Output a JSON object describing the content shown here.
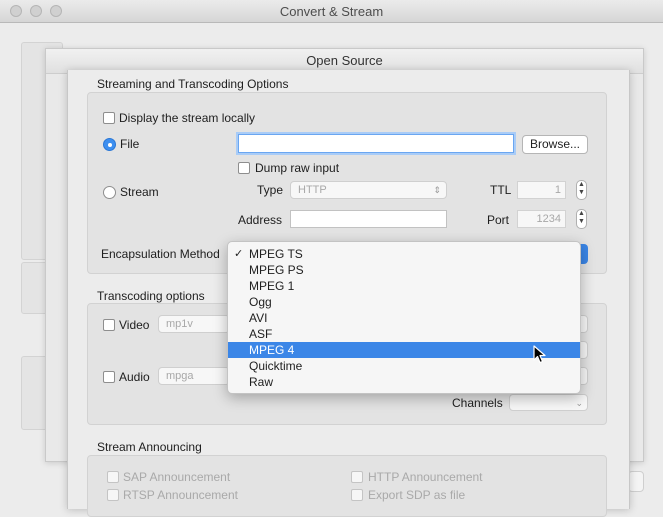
{
  "window": {
    "title": "Convert & Stream"
  },
  "open_source": {
    "title": "Open Source"
  },
  "streaming": {
    "section_title": "Streaming and Transcoding Options",
    "display_locally": "Display the stream locally",
    "file_label": "File",
    "file_path": "",
    "browse_label": "Browse...",
    "dump_raw_label": "Dump raw input",
    "stream_label": "Stream",
    "type_label": "Type",
    "type_value": "HTTP",
    "ttl_label": "TTL",
    "ttl_value": "1",
    "address_label": "Address",
    "address_value": "",
    "port_label": "Port",
    "port_value": "1234",
    "encapsulation_label": "Encapsulation Method",
    "encapsulation_options": [
      "MPEG TS",
      "MPEG PS",
      "MPEG 1",
      "Ogg",
      "AVI",
      "ASF",
      "MPEG 4",
      "Quicktime",
      "Raw"
    ],
    "encapsulation_checked": "MPEG TS",
    "encapsulation_highlighted": "MPEG 4"
  },
  "transcoding": {
    "section_title": "Transcoding options",
    "video_label": "Video",
    "video_codec": "mp1v",
    "audio_label": "Audio",
    "audio_codec": "mpga",
    "channels_label": "Channels"
  },
  "announcing": {
    "section_title": "Stream Announcing",
    "sap": "SAP Announcement",
    "rtsp": "RTSP Announcement",
    "http": "HTTP Announcement",
    "sdp": "Export SDP as file"
  },
  "colors": {
    "accent": "#3b86e7",
    "focus_ring": "#a9ccf7"
  }
}
